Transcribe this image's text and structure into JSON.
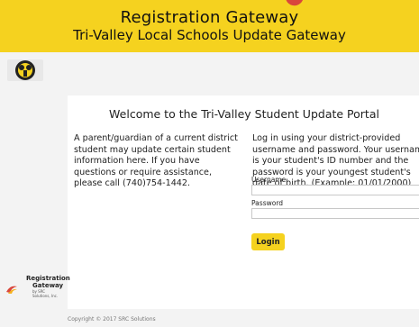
{
  "header": {
    "title": "Registration Gateway",
    "subtitle": "Tri-Valley Local Schools Update Gateway",
    "background": "#f5d21f"
  },
  "school_logo": {
    "icon": "school-seal-icon"
  },
  "panel": {
    "title": "Welcome to the Tri-Valley Student Update Portal",
    "intro_text": "A parent/guardian of a current district student may update certain student information here. If you have questions or require assistance, please call (740)754-1442.",
    "login_instructions": "Log in using your district-provided username and password. Your username is your student's ID number and the password is your youngest student's date of birth. (Example: 01/01/2000)",
    "username_label": "Username",
    "username_value": "",
    "password_label": "Password",
    "password_value": "",
    "login_button": "Login"
  },
  "footer": {
    "brand_line1": "Registration",
    "brand_line2": "Gateway",
    "brand_by": "by SRC Solutions, Inc.",
    "copyright": "Copyright © 2017 SRC Solutions"
  }
}
